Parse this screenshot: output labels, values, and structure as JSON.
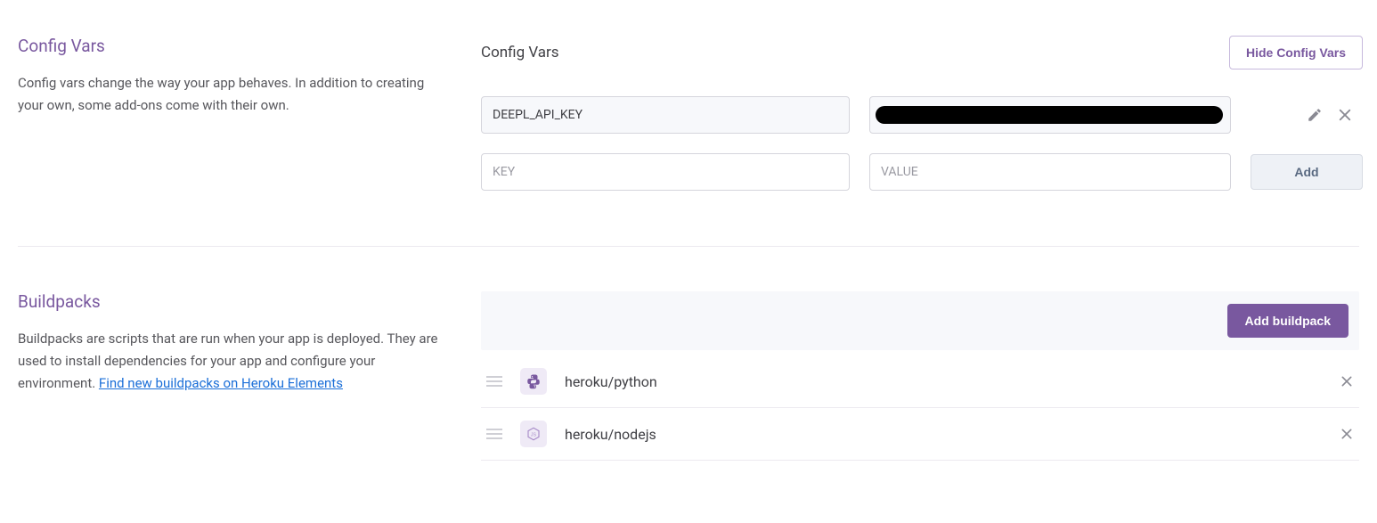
{
  "configVars": {
    "leftTitle": "Config Vars",
    "description": "Config vars change the way your app behaves. In addition to creating your own, some add-ons come with their own.",
    "rightTitle": "Config Vars",
    "hideButton": "Hide Config Vars",
    "existingKey": "DEEPL_API_KEY",
    "keyPlaceholder": "KEY",
    "valuePlaceholder": "VALUE",
    "addButton": "Add"
  },
  "buildpacks": {
    "leftTitle": "Buildpacks",
    "descriptionPrefix": "Buildpacks are scripts that are run when your app is deployed. They are used to install dependencies for your app and configure your environment. ",
    "linkText": "Find new buildpacks on Heroku Elements",
    "addButton": "Add buildpack",
    "items": [
      {
        "name": "heroku/python",
        "icon": "python"
      },
      {
        "name": "heroku/nodejs",
        "icon": "nodejs"
      }
    ]
  }
}
